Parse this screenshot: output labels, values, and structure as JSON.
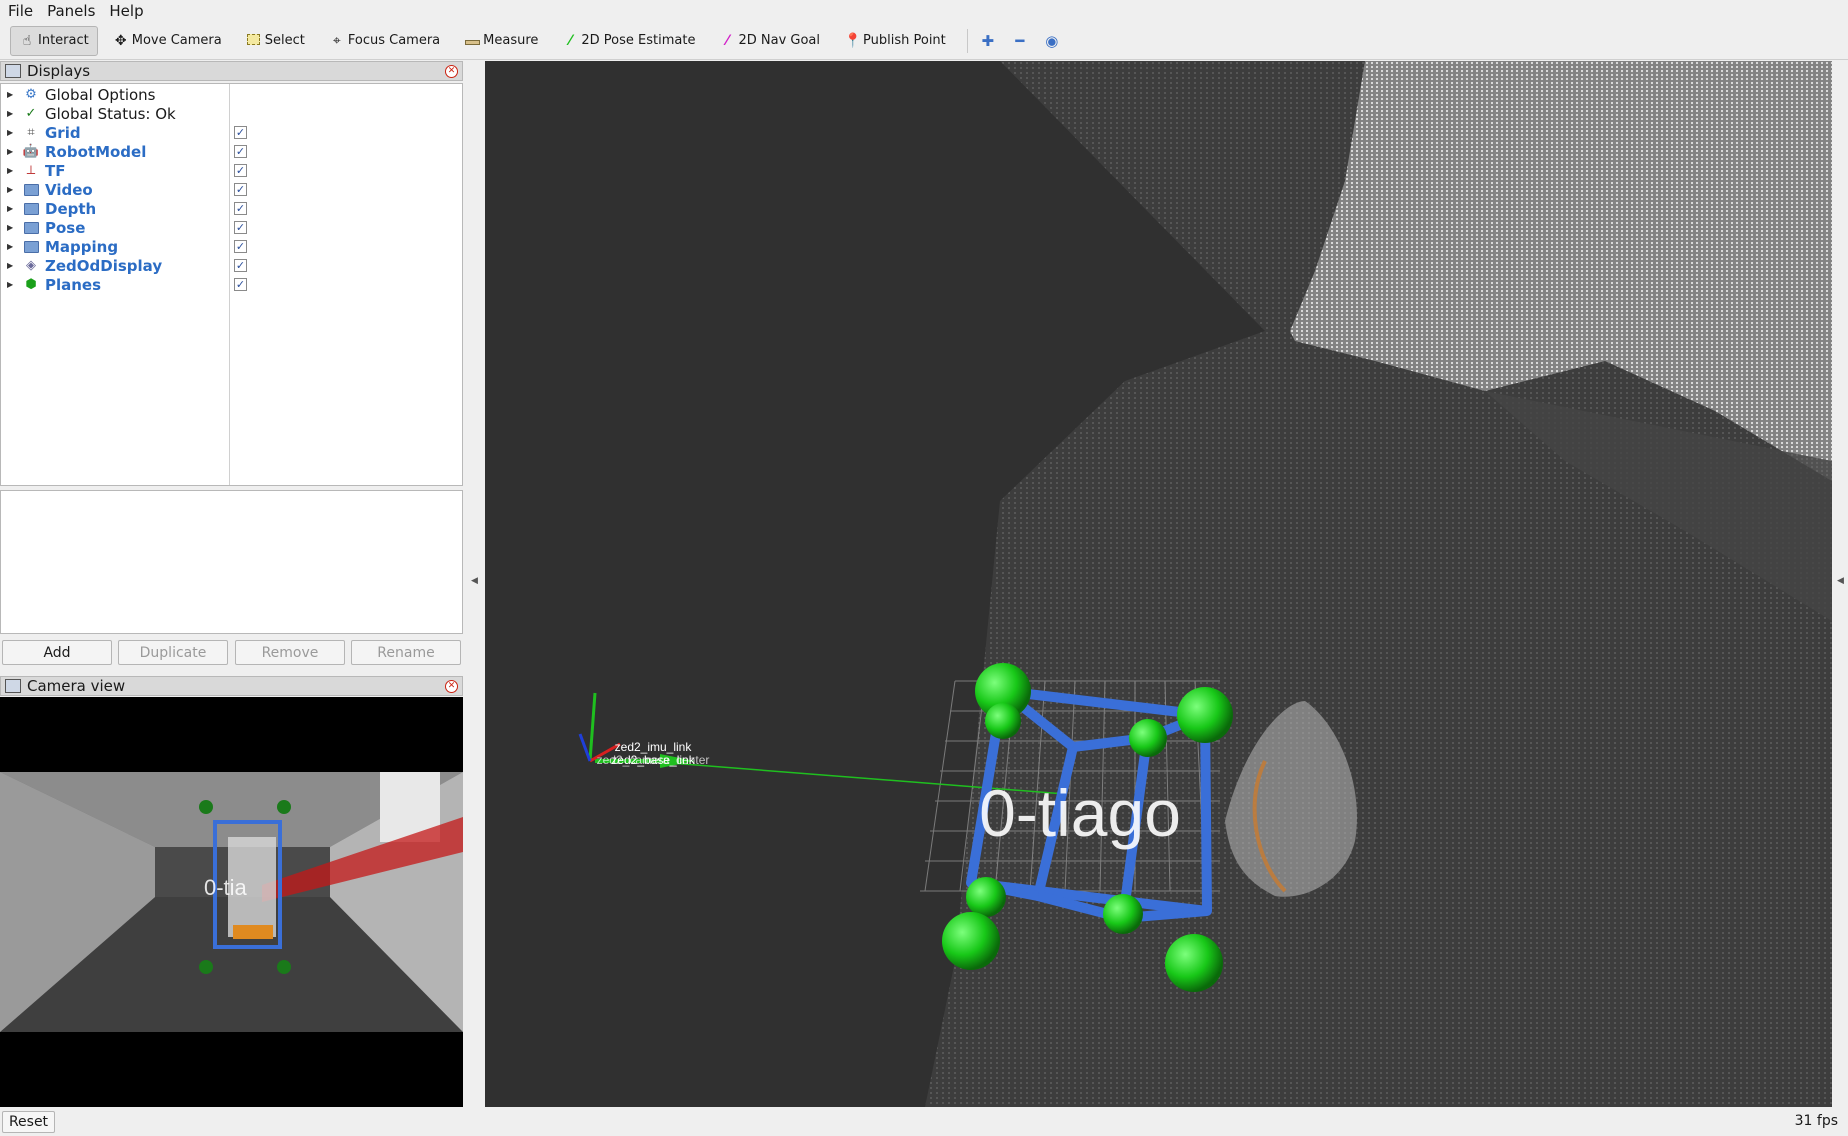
{
  "menu": [
    "File",
    "Panels",
    "Help"
  ],
  "toolbar": {
    "tools": [
      {
        "label": "Interact",
        "icon": "cursor-icon",
        "active": true
      },
      {
        "label": "Move Camera",
        "icon": "move-camera-icon",
        "active": false
      },
      {
        "label": "Select",
        "icon": "select-icon",
        "active": false
      },
      {
        "label": "Focus Camera",
        "icon": "focus-camera-icon",
        "active": false
      },
      {
        "label": "Measure",
        "icon": "measure-icon",
        "active": false
      },
      {
        "label": "2D Pose Estimate",
        "icon": "pose-estimate-icon",
        "active": false
      },
      {
        "label": "2D Nav Goal",
        "icon": "nav-goal-icon",
        "active": false
      },
      {
        "label": "Publish Point",
        "icon": "publish-point-icon",
        "active": false
      }
    ],
    "extra_icons": [
      "add-tool-icon",
      "remove-tool-icon",
      "view-options-icon"
    ]
  },
  "displays_panel": {
    "title": "Displays",
    "items": [
      {
        "label": "Global Options",
        "checked": null,
        "icon": "global-options-icon",
        "bold": false
      },
      {
        "label": "Global Status: Ok",
        "checked": null,
        "icon": "status-ok-icon",
        "bold": false
      },
      {
        "label": "Grid",
        "checked": true,
        "icon": "grid-icon",
        "bold": true
      },
      {
        "label": "RobotModel",
        "checked": true,
        "icon": "robot-model-icon",
        "bold": true
      },
      {
        "label": "TF",
        "checked": true,
        "icon": "tf-icon",
        "bold": true
      },
      {
        "label": "Video",
        "checked": true,
        "icon": "folder-icon",
        "bold": true
      },
      {
        "label": "Depth",
        "checked": true,
        "icon": "folder-icon",
        "bold": true
      },
      {
        "label": "Pose",
        "checked": true,
        "icon": "folder-icon",
        "bold": true
      },
      {
        "label": "Mapping",
        "checked": true,
        "icon": "folder-icon",
        "bold": true
      },
      {
        "label": "ZedOdDisplay",
        "checked": true,
        "icon": "zed-od-icon",
        "bold": true
      },
      {
        "label": "Planes",
        "checked": true,
        "icon": "planes-icon",
        "bold": true
      }
    ],
    "buttons": {
      "add": "Add",
      "duplicate": "Duplicate",
      "remove": "Remove",
      "rename": "Rename"
    }
  },
  "camera_panel": {
    "title": "Camera view",
    "overlay_label": "0-tia"
  },
  "viewport": {
    "object_label": "0-tiago",
    "tf_labels": [
      "zed2_imu_link",
      "zed2_base_link",
      "zed2_camera_center"
    ]
  },
  "status": {
    "reset": "Reset",
    "fps": "31 fps"
  },
  "colors": {
    "accent": "#2b6cc4",
    "box": "#3a6fd8",
    "sphere": "#15c515",
    "viewport_bg": "#303030"
  }
}
